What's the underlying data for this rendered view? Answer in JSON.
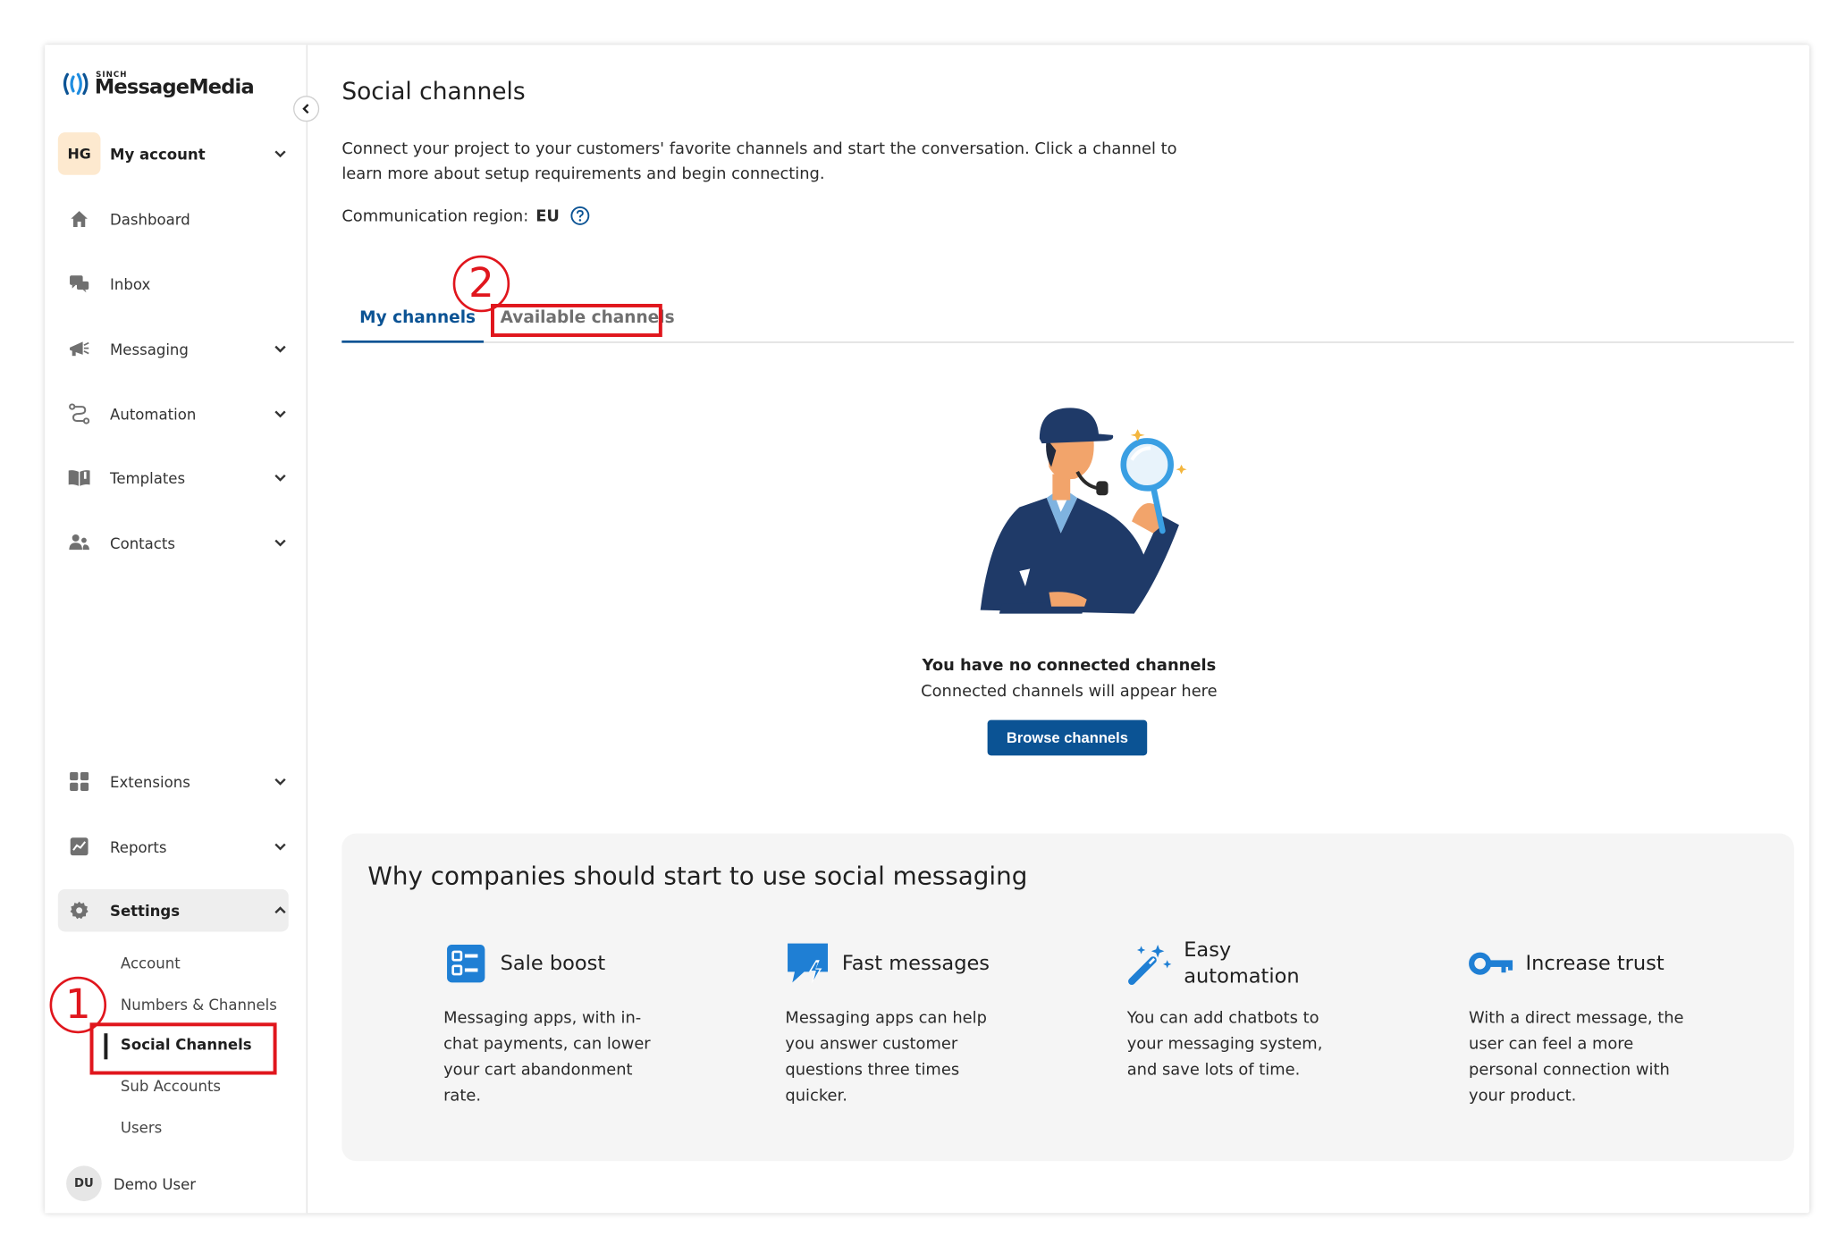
{
  "brand": {
    "small": "SINCH",
    "name": "MessageMedia",
    "accent": "#0b5394"
  },
  "account": {
    "initials": "HG",
    "label": "My account"
  },
  "sidebar": {
    "items": [
      {
        "label": "Dashboard",
        "icon": "home-icon"
      },
      {
        "label": "Inbox",
        "icon": "chat-icon"
      },
      {
        "label": "Messaging",
        "icon": "megaphone-icon"
      },
      {
        "label": "Automation",
        "icon": "flow-icon"
      },
      {
        "label": "Templates",
        "icon": "book-icon"
      },
      {
        "label": "Contacts",
        "icon": "people-icon"
      },
      {
        "label": "Extensions",
        "icon": "grid-icon"
      },
      {
        "label": "Reports",
        "icon": "chart-icon"
      },
      {
        "label": "Settings",
        "icon": "gear-icon"
      }
    ],
    "settings_sub": [
      "Account",
      "Numbers & Channels",
      "Social Channels",
      "Sub Accounts",
      "Users"
    ]
  },
  "user": {
    "initials": "DU",
    "name": "Demo User"
  },
  "page": {
    "title": "Social channels",
    "intro": "Connect your project to your customers' favorite channels and start the conversation. Click a channel to learn more about setup requirements and begin connecting.",
    "region_label": "Communication region:",
    "region_value": "EU"
  },
  "tabs": {
    "mine": "My channels",
    "available": "Available channels"
  },
  "empty": {
    "title": "You have no connected channels",
    "subtitle": "Connected channels will appear here",
    "button": "Browse channels"
  },
  "why": {
    "title": "Why companies should start to use social messaging",
    "features": [
      {
        "title": "Sale boost",
        "body": "Messaging apps, with in-chat payments, can lower your cart abandonment rate.",
        "icon": "list-icon"
      },
      {
        "title": "Fast messages",
        "body": "Messaging apps can help you answer customer questions three times quicker.",
        "icon": "lightning-chat-icon"
      },
      {
        "title": "Easy automation",
        "body": "You can add chatbots to your messaging system, and save lots of time.",
        "icon": "magic-wand-icon"
      },
      {
        "title": "Increase trust",
        "body": "With a direct message, the user can feel a more personal connection with your product.",
        "icon": "key-icon"
      }
    ]
  },
  "annotations": {
    "step1": "1",
    "step2": "2",
    "color": "#e0161d"
  }
}
